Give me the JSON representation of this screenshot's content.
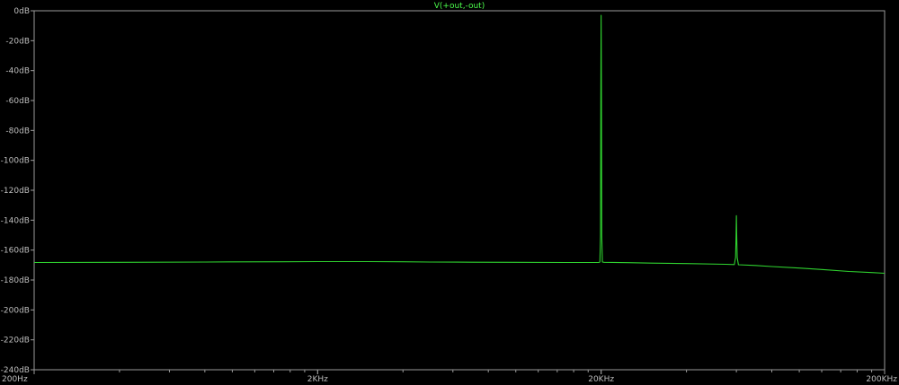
{
  "chart_data": {
    "type": "line",
    "title": "V(+out,-out)",
    "xlabel": "",
    "ylabel": "",
    "x_scale": "log",
    "xlim": [
      200,
      200000
    ],
    "ylim": [
      -240,
      0
    ],
    "grid": false,
    "x_ticks": [
      {
        "value": 200,
        "label": "200Hz"
      },
      {
        "value": 2000,
        "label": "2KHz"
      },
      {
        "value": 20000,
        "label": "20KHz"
      },
      {
        "value": 200000,
        "label": "200KHz"
      }
    ],
    "y_ticks": [
      {
        "value": 0,
        "label": "0dB"
      },
      {
        "value": -20,
        "label": "-20dB"
      },
      {
        "value": -40,
        "label": "-40dB"
      },
      {
        "value": -60,
        "label": "-60dB"
      },
      {
        "value": -80,
        "label": "-80dB"
      },
      {
        "value": -100,
        "label": "-100dB"
      },
      {
        "value": -120,
        "label": "-120dB"
      },
      {
        "value": -140,
        "label": "-140dB"
      },
      {
        "value": -160,
        "label": "-160dB"
      },
      {
        "value": -180,
        "label": "-180dB"
      },
      {
        "value": -200,
        "label": "-200dB"
      },
      {
        "value": -220,
        "label": "-220dB"
      },
      {
        "value": -240,
        "label": "-240dB"
      }
    ],
    "colors": {
      "background": "#000000",
      "axis": "#9a9a9a",
      "trace": "#2fd22f",
      "title": "#4cff4c",
      "tick_label": "#bdbdbd"
    },
    "series": [
      {
        "name": "V(+out,-out)",
        "color": "#2fd22f",
        "points": [
          [
            200,
            -168.3
          ],
          [
            400,
            -168.2
          ],
          [
            800,
            -168.0
          ],
          [
            1000,
            -167.9
          ],
          [
            1500,
            -167.8
          ],
          [
            2000,
            -167.7
          ],
          [
            3000,
            -167.7
          ],
          [
            4000,
            -167.8
          ],
          [
            5000,
            -168.0
          ],
          [
            7000,
            -168.1
          ],
          [
            10000,
            -168.2
          ],
          [
            15000,
            -168.3
          ],
          [
            19600,
            -168.3
          ],
          [
            19800,
            -168.0
          ],
          [
            19900,
            -150.0
          ],
          [
            19950,
            -60.0
          ],
          [
            20000,
            -3.0
          ],
          [
            20050,
            -60.0
          ],
          [
            20100,
            -150.0
          ],
          [
            20200,
            -168.0
          ],
          [
            20500,
            -168.2
          ],
          [
            25000,
            -168.4
          ],
          [
            30000,
            -168.7
          ],
          [
            40000,
            -169.0
          ],
          [
            55000,
            -169.5
          ],
          [
            59000,
            -169.7
          ],
          [
            59600,
            -165.0
          ],
          [
            59850,
            -150.0
          ],
          [
            60000,
            -137.0
          ],
          [
            60150,
            -150.0
          ],
          [
            60400,
            -165.0
          ],
          [
            61000,
            -169.8
          ],
          [
            70000,
            -170.3
          ],
          [
            80000,
            -171.0
          ],
          [
            100000,
            -172.0
          ],
          [
            120000,
            -173.0
          ],
          [
            150000,
            -174.3
          ],
          [
            180000,
            -175.0
          ],
          [
            200000,
            -175.5
          ]
        ]
      }
    ]
  }
}
